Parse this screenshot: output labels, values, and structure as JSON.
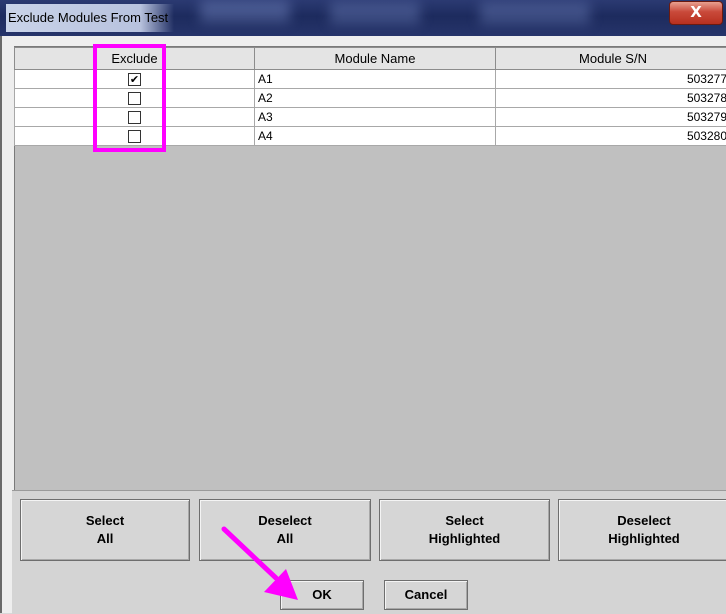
{
  "window": {
    "title": "Exclude Modules From Test",
    "close_glyph": "X"
  },
  "table": {
    "columns": [
      "Exclude",
      "Module Name",
      "Module S/N"
    ],
    "rows": [
      {
        "exclude": true,
        "name": "A1",
        "sn": "503277"
      },
      {
        "exclude": false,
        "name": "A2",
        "sn": "503278"
      },
      {
        "exclude": false,
        "name": "A3",
        "sn": "503279"
      },
      {
        "exclude": false,
        "name": "A4",
        "sn": "503280"
      }
    ]
  },
  "buttons": {
    "select_all": "Select\nAll",
    "deselect_all": "Deselect\nAll",
    "select_highlighted": "Select\nHighlighted",
    "deselect_highlighted": "Deselect\nHighlighted",
    "ok": "OK",
    "cancel": "Cancel"
  },
  "annotations": {
    "highlight_color": "#ff00ff",
    "arrow_color": "#ff00ff",
    "checkmark_glyph": "✔"
  }
}
